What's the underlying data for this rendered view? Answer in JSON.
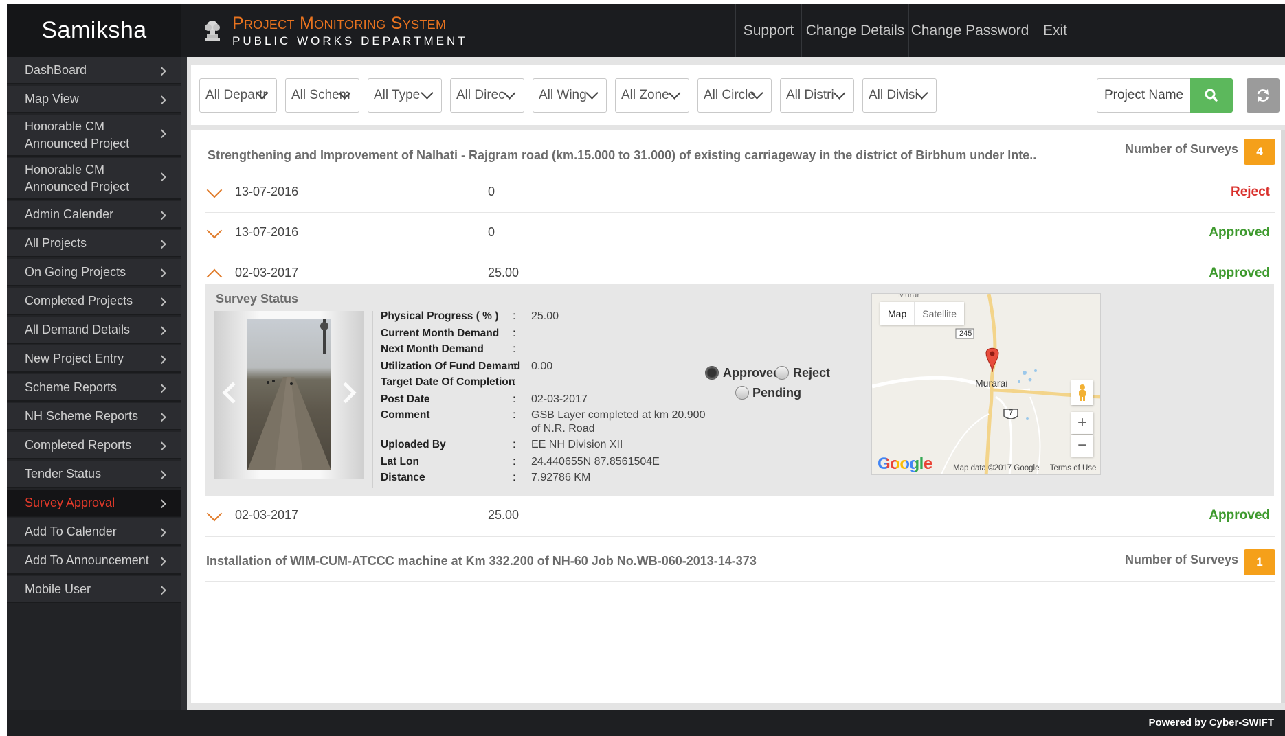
{
  "app": {
    "brand": "Samiksha",
    "system_title": "Project Monitoring System",
    "system_subtitle": "PUBLIC WORKS DEPARTMENT"
  },
  "topnav": {
    "support": "Support",
    "change_details": "Change Details",
    "change_password": "Change Password",
    "exit": "Exit"
  },
  "sidebar": {
    "items": [
      {
        "label": "DashBoard"
      },
      {
        "label": "Map View"
      },
      {
        "label": "Honorable CM Announced Project"
      },
      {
        "label": "Honorable CM Announced Project"
      },
      {
        "label": "Admin Calender"
      },
      {
        "label": "All Projects"
      },
      {
        "label": "On Going Projects"
      },
      {
        "label": "Completed Projects"
      },
      {
        "label": "All Demand Details"
      },
      {
        "label": "New Project Entry"
      },
      {
        "label": "Scheme Reports"
      },
      {
        "label": "NH Scheme Reports"
      },
      {
        "label": "Completed Reports"
      },
      {
        "label": "Tender Status"
      },
      {
        "label": "Survey Approval"
      },
      {
        "label": "Add To Calender"
      },
      {
        "label": "Add To Announcement"
      },
      {
        "label": "Mobile User"
      }
    ],
    "active": "Survey Approval"
  },
  "filters": {
    "department": "All Departr",
    "scheme": "All Schem",
    "type": "All Type",
    "directorate": "All Directo",
    "wing": "All Wing",
    "zone": "All Zone",
    "circle": "All Circle",
    "district": "All Distric",
    "division": "All Divisio",
    "project_name_placeholder": "Project Name"
  },
  "projects": [
    {
      "title": "Strengthening and Improvement of Nalhati - Rajgram road (km.15.000 to 31.000) of existing carriageway in the district of Birbhum under Inte..",
      "surveys_label": "Number of Surveys",
      "surveys_count": "4",
      "surveys": [
        {
          "date": "13-07-2016",
          "value": "0",
          "status": "Reject"
        },
        {
          "date": "13-07-2016",
          "value": "0",
          "status": "Approved"
        },
        {
          "date": "02-03-2017",
          "value": "25.00",
          "status": "Approved"
        },
        {
          "date": "02-03-2017",
          "value": "25.00",
          "status": "Approved"
        }
      ]
    },
    {
      "title": "Installation of WIM-CUM-ATCCC machine at Km 332.200 of NH-60 Job No.WB-060-2013-14-373",
      "surveys_label": "Number of Surveys",
      "surveys_count": "1"
    }
  ],
  "survey_detail": {
    "heading": "Survey Status",
    "colon": ":",
    "fields": {
      "physical_progress": {
        "label": "Physical Progress ( % )",
        "value": "25.00"
      },
      "current_month_demand": {
        "label": "Current Month Demand",
        "value": ""
      },
      "next_month_demand": {
        "label": "Next Month Demand",
        "value": ""
      },
      "utilization": {
        "label": "Utilization Of Fund Demand",
        "value": "0.00"
      },
      "target_date": {
        "label": "Target Date Of Completion",
        "value": ""
      },
      "post_date": {
        "label": "Post Date",
        "value": "02-03-2017"
      },
      "comment": {
        "label": "Comment",
        "value_line1": "GSB Layer completed at km 20.900",
        "value_line2": "of N.R. Road"
      },
      "uploaded_by": {
        "label": "Uploaded By",
        "value": "EE NH Division XII"
      },
      "lat_lon": {
        "label": "Lat Lon",
        "value": "24.440655N 87.8561504E"
      },
      "distance": {
        "label": "Distance",
        "value": "7.92786 KM"
      }
    },
    "status_options": [
      "Approved",
      "Reject",
      "Pending"
    ],
    "selected_status": "Approved"
  },
  "map": {
    "tab_map": "Map",
    "tab_satellite": "Satellite",
    "place_label": "Murarai",
    "top_label": "Murar",
    "road_shield_1": "245",
    "road_shield_2": "7",
    "logo": "Google",
    "credit": "Map data ©2017 Google",
    "terms": "Terms of Use"
  },
  "footer": {
    "text": "Powered by Cyber-SWIFT"
  },
  "colors": {
    "accent_orange": "#e8731f",
    "badge": "#f5a01a",
    "search_green": "#5cb85c",
    "reject_red": "#d9302c",
    "approved_green": "#3e9a2e",
    "active_menu_red": "#e53a2a"
  },
  "icons": {
    "search": "search-icon",
    "refresh": "refresh-icon",
    "emblem": "emblem-icon",
    "pegman": "pegman-icon",
    "map_marker": "map-marker-icon"
  }
}
